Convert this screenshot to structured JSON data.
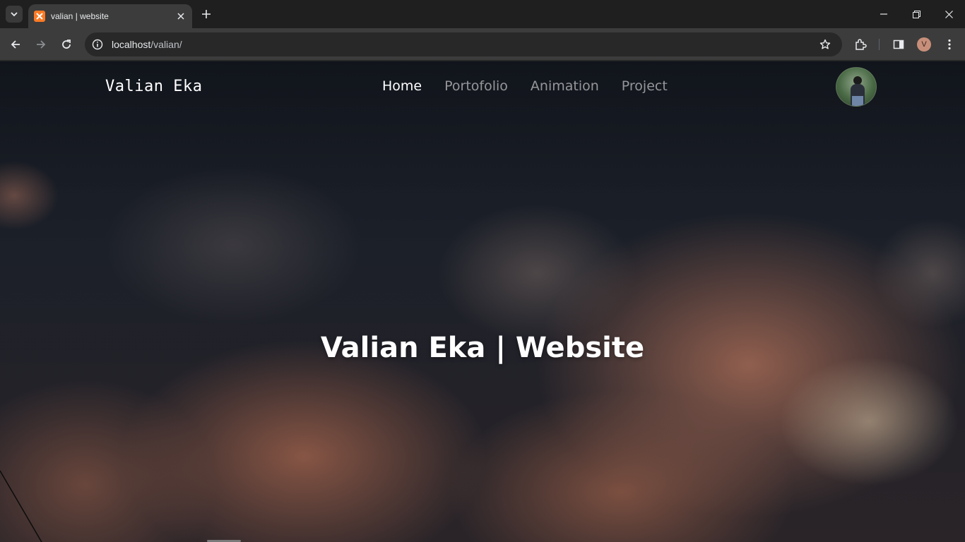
{
  "browser": {
    "tab": {
      "title": "valian | website"
    },
    "address": {
      "host": "localhost",
      "path": "/valian/"
    },
    "profile_initial": "V",
    "icons": [
      "tab-search-icon",
      "close-icon",
      "plus-icon",
      "minimize-icon",
      "restore-icon",
      "back-icon",
      "forward-icon",
      "reload-icon",
      "info-icon",
      "star-icon",
      "extensions-icon",
      "side-panel-icon",
      "more-icon"
    ]
  },
  "site": {
    "brand": "Valian Eka",
    "nav": [
      {
        "label": "Home",
        "active": true
      },
      {
        "label": "Portofolio",
        "active": false
      },
      {
        "label": "Animation",
        "active": false
      },
      {
        "label": "Project",
        "active": false
      }
    ],
    "hero_title": "Valian Eka | Website"
  },
  "colors": {
    "chrome_dark": "#1f1f1f",
    "chrome_toolbar": "#3c3c3c",
    "favicon_accent": "#fb7a24",
    "nav_active": "#ffffff"
  }
}
